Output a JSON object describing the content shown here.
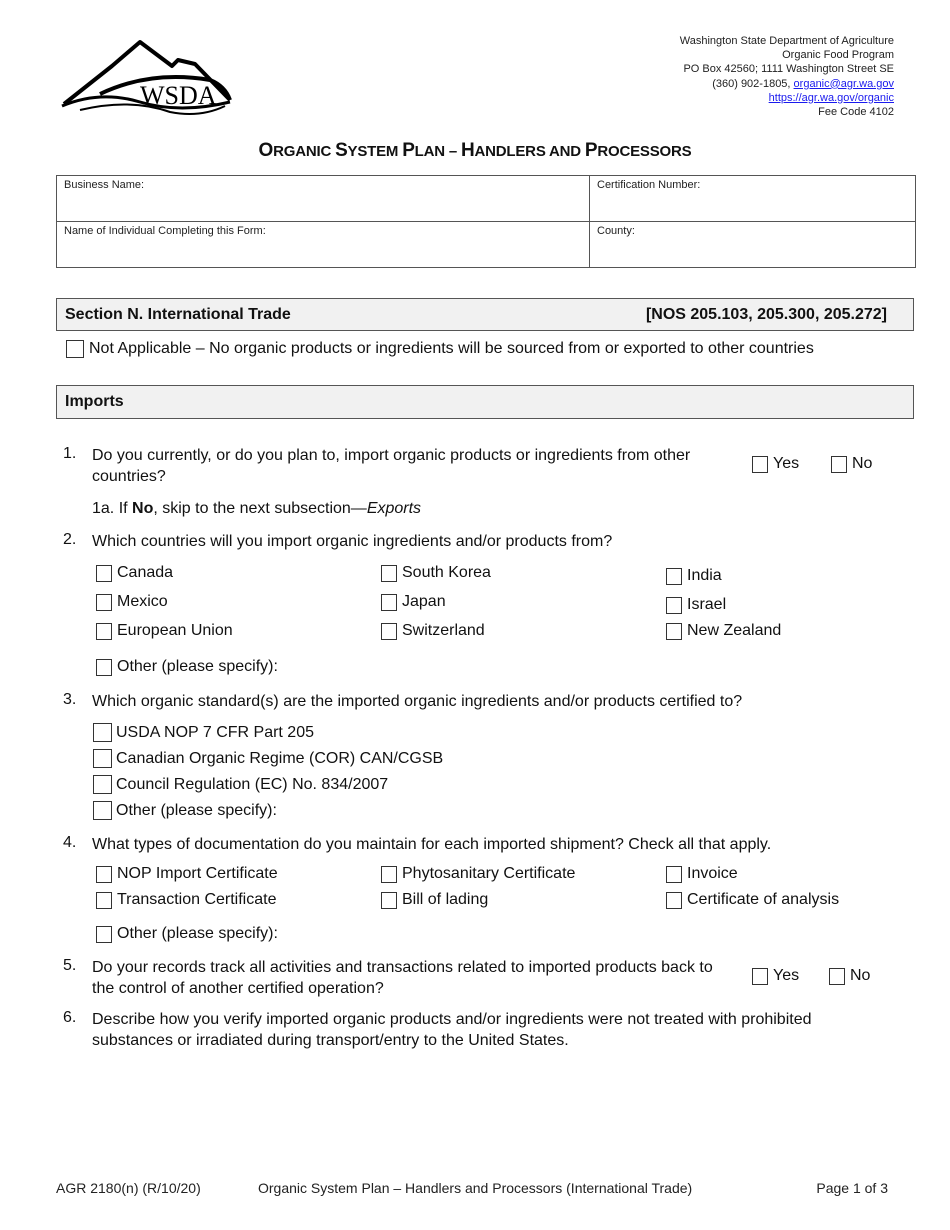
{
  "header": {
    "logo_text": "WSDA",
    "agency": {
      "name": "Washington State Department of Agriculture",
      "program": "Organic Food Program",
      "address": "PO Box 42560; 1111 Washington Street SE",
      "phone": "(360) 902-1805, ",
      "email": "organic@agr.wa.gov",
      "website": "https://agr.wa.gov/organic",
      "fee_code": "Fee Code 4102"
    },
    "title_parts": [
      {
        "cap": "O",
        "rest": "RGANIC "
      },
      {
        "cap": "S",
        "rest": "YSTEM "
      },
      {
        "cap": "P",
        "rest": "LAN – "
      },
      {
        "cap": "H",
        "rest": "ANDLERS AND "
      },
      {
        "cap": "P",
        "rest": "ROCESSORS"
      }
    ]
  },
  "info_fields": {
    "business_name": "Business Name:",
    "certification_number": "Certification Number:",
    "individual_name": "Name of Individual Completing this Form:",
    "county": "County:"
  },
  "section": {
    "title": "Section N.  International Trade",
    "reference": "[NOS 205.103, 205.300, 205.272]"
  },
  "not_applicable": "Not Applicable – No organic products or ingredients will be sourced from or exported to other countries",
  "subsection": "Imports",
  "questions": {
    "q1": {
      "num": "1.",
      "text": "Do you currently, or do you plan to, import organic products or ingredients from other countries?",
      "yes": "Yes",
      "no": "No",
      "sub_prefix": "1a.  If ",
      "sub_bold": "No",
      "sub_mid": ", skip to the next subsection—",
      "sub_italic": "Exports"
    },
    "q2": {
      "num": "2.",
      "text": "Which countries will you import organic ingredients and/or products from?",
      "options": [
        "Canada",
        "Mexico",
        "European Union",
        "South Korea",
        "Japan",
        "Switzerland",
        "India",
        "Israel",
        "New Zealand"
      ],
      "other": "Other (please specify):"
    },
    "q3": {
      "num": "3.",
      "text": "Which organic standard(s) are the imported organic ingredients and/or products certified to?",
      "options": [
        "USDA NOP 7 CFR Part 205",
        "Canadian Organic Regime (COR) CAN/CGSB",
        "Council Regulation (EC) No. 834/2007",
        "Other (please specify):"
      ]
    },
    "q4": {
      "num": "4.",
      "text": "What types of documentation do you maintain for each imported shipment? Check all that apply.",
      "options": [
        "NOP Import Certificate",
        "Transaction Certificate",
        "Phytosanitary Certificate",
        "Bill of lading",
        "Invoice",
        "Certificate of analysis"
      ],
      "other": "Other (please specify):"
    },
    "q5": {
      "num": "5.",
      "text": "Do your records track all activities and transactions related to imported products back to the control of another certified operation?",
      "yes": "Yes",
      "no": "No"
    },
    "q6": {
      "num": "6.",
      "text": "Describe how you verify imported organic products and/or ingredients were not treated with prohibited substances or irradiated during transport/entry to the United States."
    }
  },
  "footer": {
    "form_id": "AGR 2180(n) (R/10/20)",
    "form_title": "Organic System Plan – Handlers and Processors (International Trade)",
    "page": "Page 1 of 3"
  }
}
